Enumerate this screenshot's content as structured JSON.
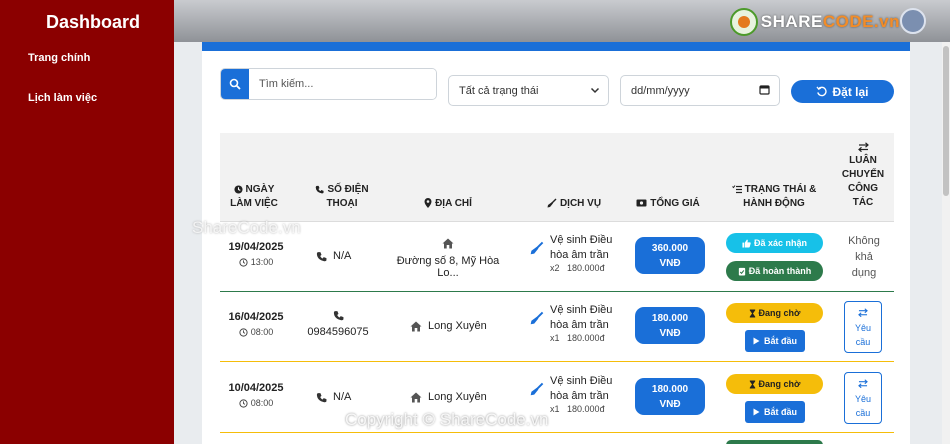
{
  "sidebar": {
    "brand": "Dashboard",
    "items": [
      {
        "label": "Trang chính"
      },
      {
        "label": "Lịch làm việc"
      }
    ]
  },
  "header": {
    "logo_text_part1": "SHARE",
    "logo_text_part2": "CODE.vn"
  },
  "filters": {
    "search_placeholder": "Tìm kiếm...",
    "status_selected": "Tất cả trạng thái",
    "date_placeholder": "dd/mm/yyyy",
    "reset_label": "Đặt lại"
  },
  "table": {
    "headers": {
      "work_date": [
        "NGÀY",
        "LÀM VIỆC"
      ],
      "phone": [
        "SỐ ĐIỆN",
        "THOẠI"
      ],
      "address": "ĐỊA CHỈ",
      "service": "DỊCH VỤ",
      "total": "TỔNG GIÁ",
      "status": [
        "TRẠNG THÁI &",
        "HÀNH ĐỘNG"
      ],
      "rotation": [
        "LUÂN",
        "CHUYỂN",
        "CÔNG",
        "TÁC"
      ]
    },
    "rows": [
      {
        "date": "19/04/2025",
        "time": "13:00",
        "phone": "N/A",
        "address": "Đường số 8, Mỹ Hòa Lo...",
        "service_line1": "Vệ sinh Điều",
        "service_line2": "hòa âm trần",
        "qty": "x2",
        "unit_price": "180.000đ",
        "total_line1": "360.000",
        "total_line2": "VNĐ",
        "status1": "Đã xác nhận",
        "status2": "Đã hoàn thành",
        "rotation": [
          "Không",
          "khả",
          "dụng"
        ]
      },
      {
        "date": "16/04/2025",
        "time": "08:00",
        "phone": "0984596075",
        "address": "Long Xuyên",
        "service_line1": "Vệ sinh Điều",
        "service_line2": "hòa âm trần",
        "qty": "x1",
        "unit_price": "180.000đ",
        "total_line1": "180.000",
        "total_line2": "VNĐ",
        "status1": "Đang chờ",
        "action": "Bắt đầu",
        "rotation": [
          "Yêu",
          "cầu"
        ]
      },
      {
        "date": "10/04/2025",
        "time": "08:00",
        "phone": "N/A",
        "address": "Long Xuyên",
        "service_line1": "Vệ sinh Điều",
        "service_line2": "hòa âm trần",
        "qty": "x1",
        "unit_price": "180.000đ",
        "total_line1": "180.000",
        "total_line2": "VNĐ",
        "status1": "Đang chờ",
        "action": "Bắt đầu",
        "rotation": [
          "Yêu",
          "cầu"
        ]
      }
    ]
  },
  "watermark": {
    "main": "Copyright © ShareCode.vn",
    "mid": "ShareCode.vn"
  },
  "colors": {
    "sidebar": "#8b0000",
    "primary": "#1a6fd8",
    "confirmed": "#17c1e8",
    "completed": "#2d7a4b",
    "pending": "#f5bd0a"
  }
}
